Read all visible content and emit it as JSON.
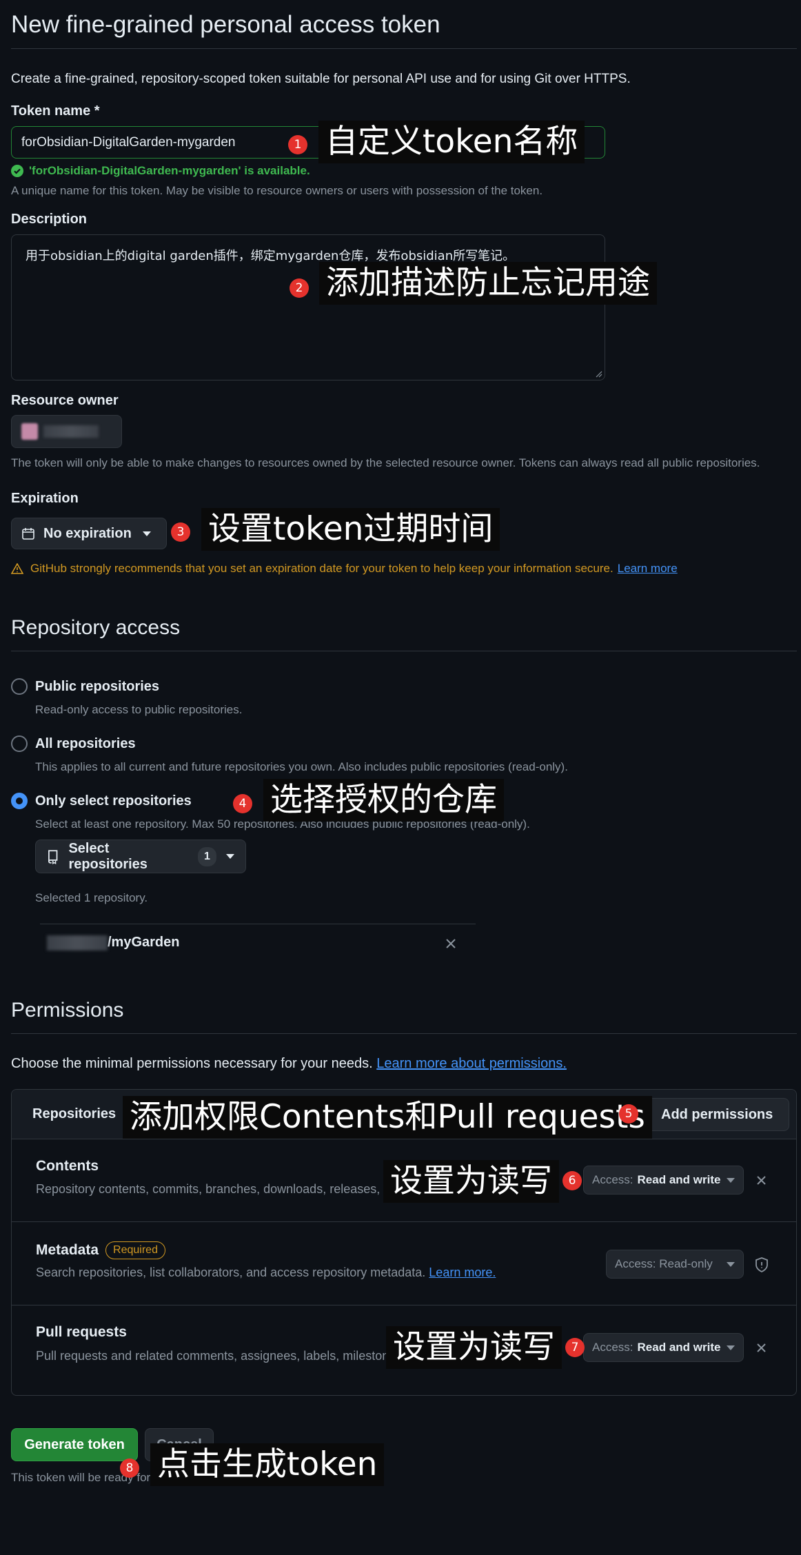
{
  "page": {
    "title": "New fine-grained personal access token",
    "intro": "Create a fine-grained, repository-scoped token suitable for personal API use and for using Git over HTTPS."
  },
  "token_name": {
    "label": "Token name *",
    "value": "forObsidian-DigitalGarden-mygarden",
    "available": "'forObsidian-DigitalGarden-mygarden' is available.",
    "hint": "A unique name for this token. May be visible to resource owners or users with possession of the token."
  },
  "description": {
    "label": "Description",
    "value": "用于obsidian上的digital garden插件，绑定mygarden仓库，发布obsidian所写笔记。"
  },
  "resource_owner": {
    "label": "Resource owner",
    "hint": "The token will only be able to make changes to resources owned by the selected resource owner. Tokens can always read all public repositories."
  },
  "expiration": {
    "label": "Expiration",
    "value": "No expiration",
    "warning": "GitHub strongly recommends that you set an expiration date for your token to help keep your information secure.",
    "learn_more": "Learn more"
  },
  "repository_access": {
    "title": "Repository access",
    "options": [
      {
        "label": "Public repositories",
        "desc": "Read-only access to public repositories."
      },
      {
        "label": "All repositories",
        "desc": "This applies to all current and future repositories you own. Also includes public repositories (read-only)."
      },
      {
        "label": "Only select repositories",
        "desc": "Select at least one repository. Max 50 repositories. Also includes public repositories (read-only)."
      }
    ],
    "select_button": "Select repositories",
    "select_count": "1",
    "selected_text": "Selected 1 repository.",
    "repo_name": "/myGarden"
  },
  "permissions": {
    "title": "Permissions",
    "intro": "Choose the minimal permissions necessary for your needs.",
    "learn_more": "Learn more about permissions.",
    "tab": "Repositories",
    "add_button": "Add permissions",
    "rows": [
      {
        "title": "Contents",
        "desc": "Repository contents, commits, branches, downloads, releases, and merges.",
        "access_prefix": "Access:",
        "access_value": "Read and write"
      },
      {
        "title": "Metadata",
        "badge": "Required",
        "desc": "Search repositories, list collaborators, and access repository metadata.",
        "learn_more": "Learn more.",
        "access_prefix": "Access: Read-only"
      },
      {
        "title": "Pull requests",
        "desc": "Pull requests and related comments, assignees, labels, milestones, and merges.",
        "access_prefix": "Access:",
        "access_value": "Read and write"
      }
    ]
  },
  "footer": {
    "generate": "Generate token",
    "cancel": "Cancel",
    "note": "This token will be ready for use immediately."
  },
  "annotations": {
    "a1": {
      "num": "1",
      "text": "自定义token名称"
    },
    "a2": {
      "num": "2",
      "text": "添加描述防止忘记用途"
    },
    "a3": {
      "num": "3",
      "text": "设置token过期时间"
    },
    "a4": {
      "num": "4",
      "text": "选择授权的仓库"
    },
    "a5": {
      "num": "5",
      "text": "添加权限Contents和Pull requests"
    },
    "a6": {
      "num": "6",
      "text": "设置为读写"
    },
    "a7": {
      "num": "7",
      "text": "设置为读写"
    },
    "a8": {
      "num": "8",
      "text": "点击生成token"
    }
  },
  "colors": {
    "background": "#0d1117",
    "accent": "#4493f8",
    "success": "#3fb950",
    "warning": "#d29922",
    "primary_button": "#238636",
    "annotation_badge": "#e5322d"
  }
}
